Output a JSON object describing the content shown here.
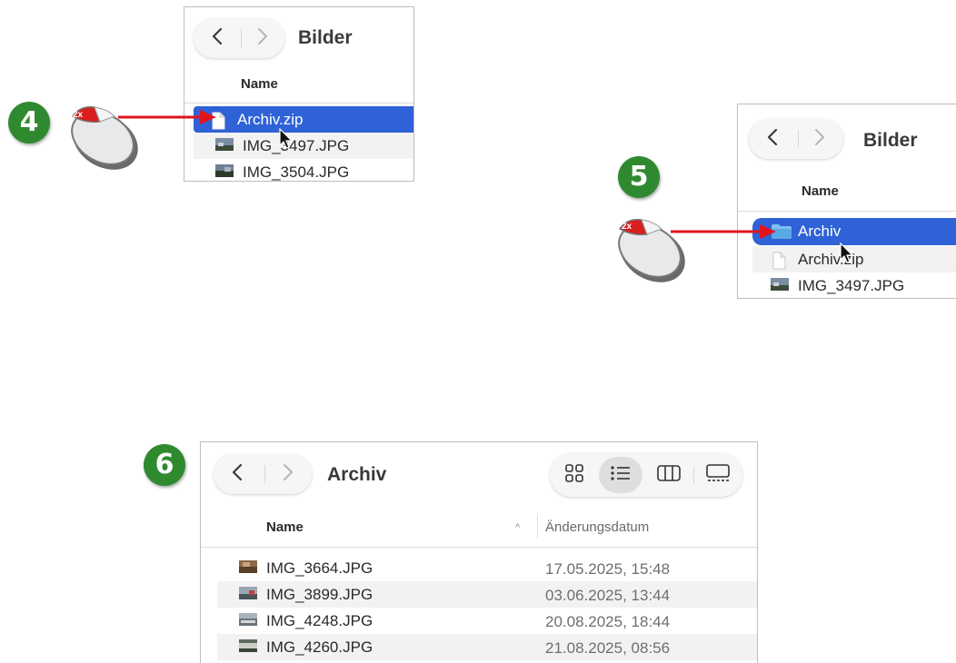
{
  "steps": [
    "4",
    "5",
    "6"
  ],
  "click_label": "2x",
  "window1": {
    "title": "Bilder",
    "column_name": "Name",
    "rows": [
      {
        "name": "Archiv.zip",
        "selected": true
      },
      {
        "name": "IMG_3497.JPG",
        "selected": false
      },
      {
        "name": "IMG_3504.JPG",
        "selected": false
      }
    ]
  },
  "window2": {
    "title": "Bilder",
    "column_name": "Name",
    "rows": [
      {
        "name": "Archiv",
        "selected": true
      },
      {
        "name": "Archiv.zip",
        "selected": false
      },
      {
        "name": "IMG_3497.JPG",
        "selected": false
      }
    ]
  },
  "window3": {
    "title": "Archiv",
    "column_name": "Name",
    "column_date": "Änderungsdatum",
    "rows": [
      {
        "name": "IMG_3664.JPG",
        "date": "17.05.2025, 15:48"
      },
      {
        "name": "IMG_3899.JPG",
        "date": "03.06.2025, 13:44"
      },
      {
        "name": "IMG_4248.JPG",
        "date": "20.08.2025, 18:44"
      },
      {
        "name": "IMG_4260.JPG",
        "date": "21.08.2025, 08:56"
      }
    ]
  },
  "colors": {
    "selection": "#2f62d6",
    "badge": "#2f8a2f",
    "arrow": "#e0141e"
  },
  "icons": [
    "back-chevron-icon",
    "forward-chevron-icon",
    "grid-view-icon",
    "list-view-icon",
    "column-view-icon",
    "gallery-view-icon",
    "document-icon",
    "folder-icon",
    "image-thumbnail-icon",
    "mouse-icon",
    "pointer-cursor-icon"
  ]
}
